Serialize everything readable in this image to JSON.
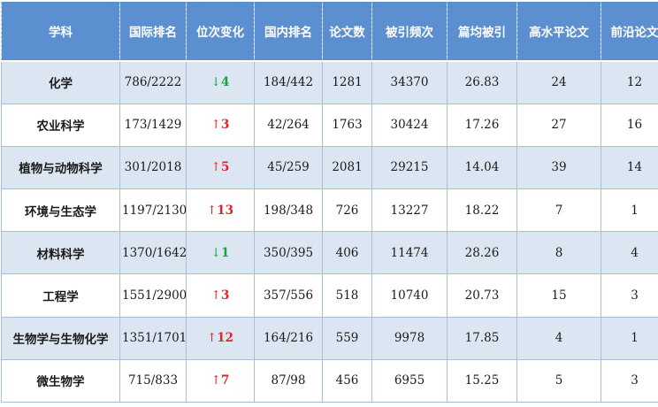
{
  "table": {
    "headers": [
      "学科",
      "国际排名",
      "位次变化",
      "国内排名",
      "论文数",
      "被引频次",
      "篇均被引",
      "高水平论文",
      "前沿论文"
    ],
    "rows": [
      {
        "subject": "化学",
        "intl_rank": "786/2222",
        "change_arrow": "↓",
        "change_value": "4",
        "change_dir": "down",
        "domestic_rank": "184/442",
        "papers": "1281",
        "citations": "34370",
        "avg_citations": "26.83",
        "high_level": "24",
        "frontier": "12"
      },
      {
        "subject": "农业科学",
        "intl_rank": "173/1429",
        "change_arrow": "↑",
        "change_value": "3",
        "change_dir": "up",
        "domestic_rank": "42/264",
        "papers": "1763",
        "citations": "30424",
        "avg_citations": "17.26",
        "high_level": "27",
        "frontier": "16"
      },
      {
        "subject": "植物与动物科学",
        "intl_rank": "301/2018",
        "change_arrow": "↑",
        "change_value": "5",
        "change_dir": "up",
        "domestic_rank": "45/259",
        "papers": "2081",
        "citations": "29215",
        "avg_citations": "14.04",
        "high_level": "39",
        "frontier": "14"
      },
      {
        "subject": "环境与生态学",
        "intl_rank": "1197/2130",
        "change_arrow": "↑",
        "change_value": "13",
        "change_dir": "up",
        "domestic_rank": "198/348",
        "papers": "726",
        "citations": "13227",
        "avg_citations": "18.22",
        "high_level": "7",
        "frontier": "1"
      },
      {
        "subject": "材料科学",
        "intl_rank": "1370/1642",
        "change_arrow": "↓",
        "change_value": "1",
        "change_dir": "down",
        "domestic_rank": "350/395",
        "papers": "406",
        "citations": "11474",
        "avg_citations": "28.26",
        "high_level": "8",
        "frontier": "4"
      },
      {
        "subject": "工程学",
        "intl_rank": "1551/2900",
        "change_arrow": "↑",
        "change_value": "3",
        "change_dir": "up",
        "domestic_rank": "357/556",
        "papers": "518",
        "citations": "10740",
        "avg_citations": "20.73",
        "high_level": "15",
        "frontier": "3"
      },
      {
        "subject": "生物学与生物化学",
        "intl_rank": "1351/1701",
        "change_arrow": "↑",
        "change_value": "12",
        "change_dir": "up",
        "domestic_rank": "164/216",
        "papers": "559",
        "citations": "9978",
        "avg_citations": "17.85",
        "high_level": "4",
        "frontier": "1"
      },
      {
        "subject": "微生物学",
        "intl_rank": "715/833",
        "change_arrow": "↑",
        "change_value": "7",
        "change_dir": "up",
        "domestic_rank": "87/98",
        "papers": "456",
        "citations": "6955",
        "avg_citations": "15.25",
        "high_level": "5",
        "frontier": "3"
      }
    ]
  },
  "colors": {
    "header_bg": "#5b8fd0",
    "header_text": "#ffffff",
    "row_alt_bg": "#dce6f2",
    "row_bg": "#ffffff",
    "rank_up": "#e52222",
    "rank_down": "#14a33c",
    "border": "#a9bfd9"
  }
}
